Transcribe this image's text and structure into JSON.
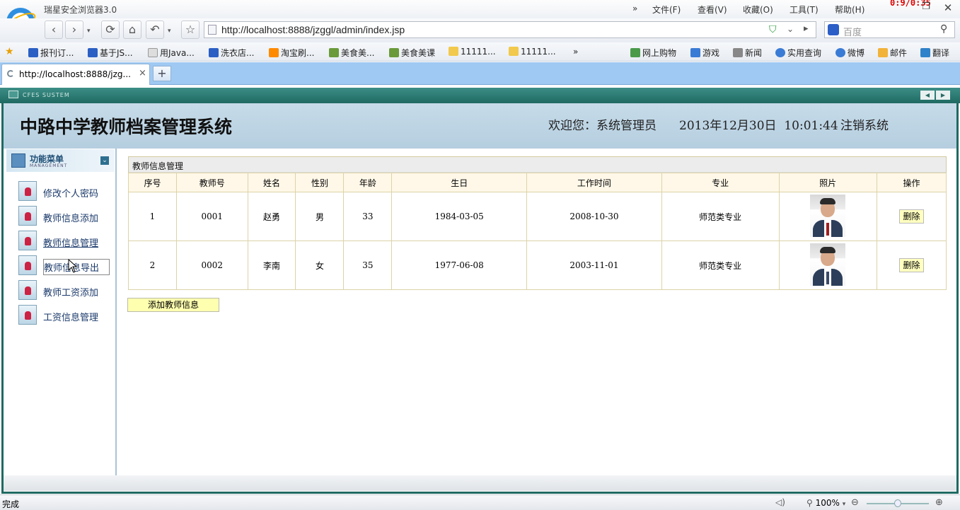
{
  "browser": {
    "app_title": "瑞星安全浏览器3.0",
    "menu": {
      "more": "»",
      "file": "文件(F)",
      "view": "查看(V)",
      "favorites": "收藏(O)",
      "tools": "工具(T)",
      "help": "帮助(H)"
    },
    "clock": "0:9/0:35",
    "url": "http://localhost:8888/jzggl/admin/index.jsp",
    "search_placeholder": "百度",
    "bookmarks": [
      "报刊订...",
      "基于JS...",
      "用Java...",
      "洗衣店...",
      "淘宝刷...",
      "美食美...",
      "美食美课",
      "11111...",
      "11111...",
      "»"
    ],
    "quick_links": [
      "网上购物",
      "游戏",
      "新闻",
      "实用查询",
      "微博",
      "邮件",
      "翻译"
    ],
    "tab_title": "http://localhost:8888/jzg...",
    "tab_close": "×",
    "new_tab": "+",
    "status": "完成",
    "zoom": "100%"
  },
  "system": {
    "bar_label": "CFES SUSTEM",
    "title": "中路中学教师档案管理系统",
    "welcome": "欢迎您：系统管理员",
    "datetime": "2013年12月30日  10:01:44",
    "logout": "注销系统"
  },
  "sidebar": {
    "title": "功能菜单",
    "subtitle": "MANAGEMENT",
    "items": [
      {
        "label": "修改个人密码"
      },
      {
        "label": "教师信息添加"
      },
      {
        "label": "教师信息管理"
      },
      {
        "label": "教师信息导出"
      },
      {
        "label": "教师工资添加"
      },
      {
        "label": "工资信息管理"
      }
    ]
  },
  "panel": {
    "title": "教师信息管理",
    "columns": [
      "序号",
      "教师号",
      "姓名",
      "性别",
      "年龄",
      "生日",
      "工作时间",
      "专业",
      "照片",
      "操作"
    ],
    "rows": [
      {
        "seq": "1",
        "id": "0001",
        "name": "赵勇",
        "gender": "男",
        "age": "33",
        "birthday": "1984-03-05",
        "work_date": "2008-10-30",
        "major": "师范类专业",
        "delete": "删除"
      },
      {
        "seq": "2",
        "id": "0002",
        "name": "李南",
        "gender": "女",
        "age": "35",
        "birthday": "1977-06-08",
        "work_date": "2003-11-01",
        "major": "师范类专业",
        "delete": "删除"
      }
    ],
    "add_button": "添加教师信息"
  }
}
